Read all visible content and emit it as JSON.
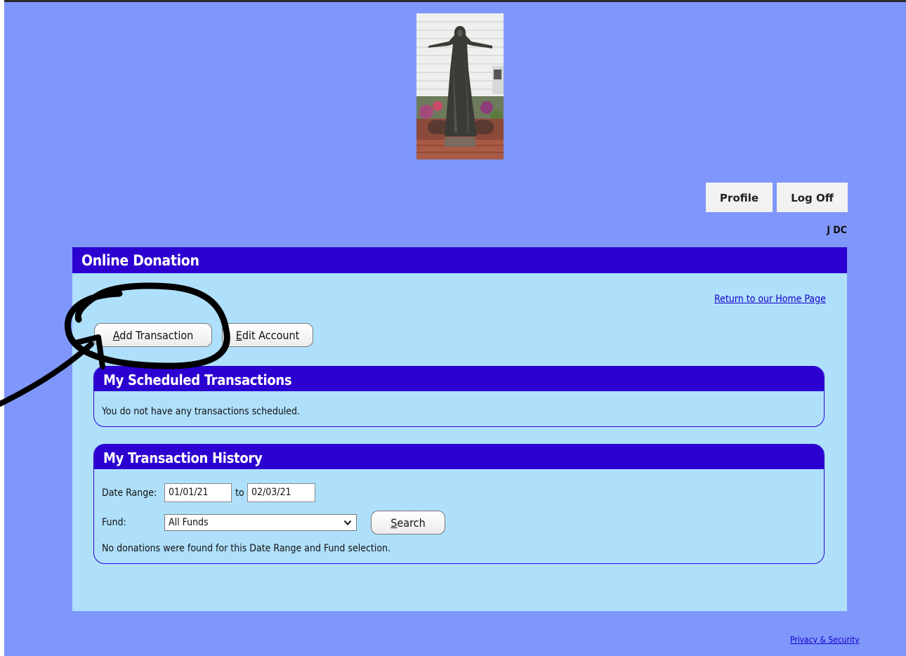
{
  "header": {
    "profile_label": "Profile",
    "logoff_label": "Log Off",
    "user_name": "J DC"
  },
  "panel": {
    "title": "Online Donation",
    "home_link": "Return to our Home Page",
    "add_transaction_access": "A",
    "add_transaction_rest": "dd Transaction",
    "edit_account_access": "E",
    "edit_account_rest": "dit Account"
  },
  "scheduled": {
    "title": "My Scheduled Transactions",
    "message": "You do not have any transactions scheduled."
  },
  "history": {
    "title": "My Transaction History",
    "date_range_label": "Date Range:",
    "date_from": "01/01/21",
    "to_label": "to",
    "date_to": "02/03/21",
    "fund_label": "Fund:",
    "fund_selected": "All Funds",
    "search_access": "S",
    "search_rest": "earch",
    "message": "No donations were found for this Date Range and Fund selection."
  },
  "footer": {
    "privacy_link": "Privacy & Security"
  },
  "colors": {
    "page_bg": "#7f97fb",
    "panel_bg": "#afe0fb",
    "header_blue": "#2b00d0",
    "link": "#1400c8"
  },
  "icons": {
    "select_chevron": "chevron-down-icon"
  }
}
